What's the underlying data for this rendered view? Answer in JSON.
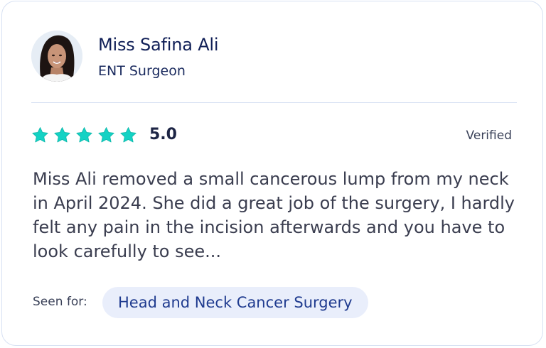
{
  "doctor": {
    "name": "Miss Safina Ali",
    "specialty": "ENT Surgeon"
  },
  "rating": {
    "stars": 5,
    "score": "5.0",
    "star_color": "#14d2c4"
  },
  "verified_label": "Verified",
  "review": {
    "text": "Miss Ali removed a small cancerous lump from my neck in April 2024. She did a great job of the surgery, I hardly felt any pain in the incision afterwards and you have to look carefully to see..."
  },
  "seen_for": {
    "label": "Seen for:",
    "treatment": "Head and Neck Cancer Surgery"
  },
  "colors": {
    "name": "#101f57",
    "border": "#d7e1f3",
    "chip_bg": "#e9eefb",
    "chip_text": "#1f3b8f"
  }
}
